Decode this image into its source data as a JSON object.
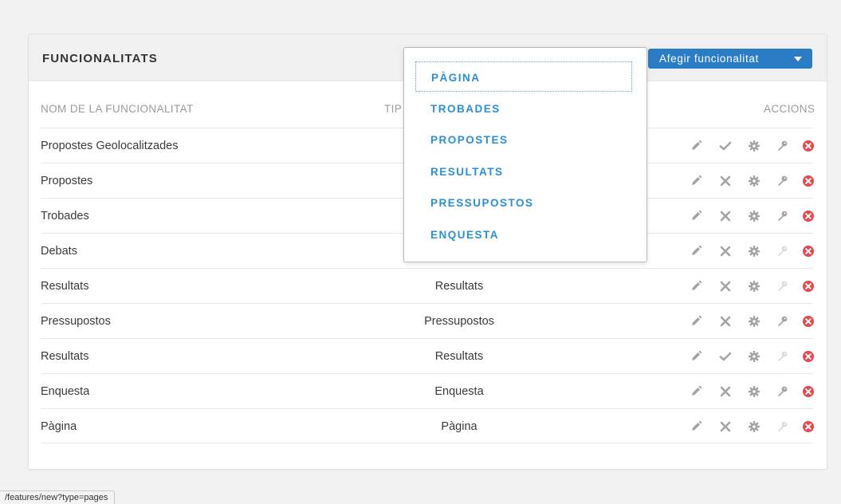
{
  "panel": {
    "title": "FUNCIONALITATS",
    "add_button_label": "Afegir funcionalitat"
  },
  "table": {
    "headers": {
      "name": "NOM DE LA FUNCIONALITAT",
      "type": "TIP",
      "actions": "ACCIONS"
    },
    "rows": [
      {
        "name": "Propostes Geolocalitzades",
        "type": "",
        "published": true,
        "permissions": true
      },
      {
        "name": "Propostes",
        "type": "",
        "published": false,
        "permissions": true
      },
      {
        "name": "Trobades",
        "type": "",
        "published": false,
        "permissions": true
      },
      {
        "name": "Debats",
        "type": "",
        "published": false,
        "permissions": false
      },
      {
        "name": "Resultats",
        "type": "Resultats",
        "published": false,
        "permissions": false
      },
      {
        "name": "Pressupostos",
        "type": "Pressupostos",
        "published": false,
        "permissions": true
      },
      {
        "name": "Resultats",
        "type": "Resultats",
        "published": true,
        "permissions": false
      },
      {
        "name": "Enquesta",
        "type": "Enquesta",
        "published": false,
        "permissions": true
      },
      {
        "name": "Pàgina",
        "type": "Pàgina",
        "published": false,
        "permissions": false
      }
    ]
  },
  "dropdown": {
    "items": [
      "PÀGINA",
      "TROBADES",
      "PROPOSTES",
      "RESULTATS",
      "PRESSUPOSTOS",
      "ENQUESTA"
    ],
    "focused_index": 0
  },
  "status_bar": {
    "url": "/features/new?type=pages"
  },
  "colors": {
    "accent": "#2a7dc5",
    "link": "#2a8fd6",
    "danger": "#e5484d",
    "icon": "#a3a3a3",
    "icon_disabled": "#dcdcdc"
  }
}
